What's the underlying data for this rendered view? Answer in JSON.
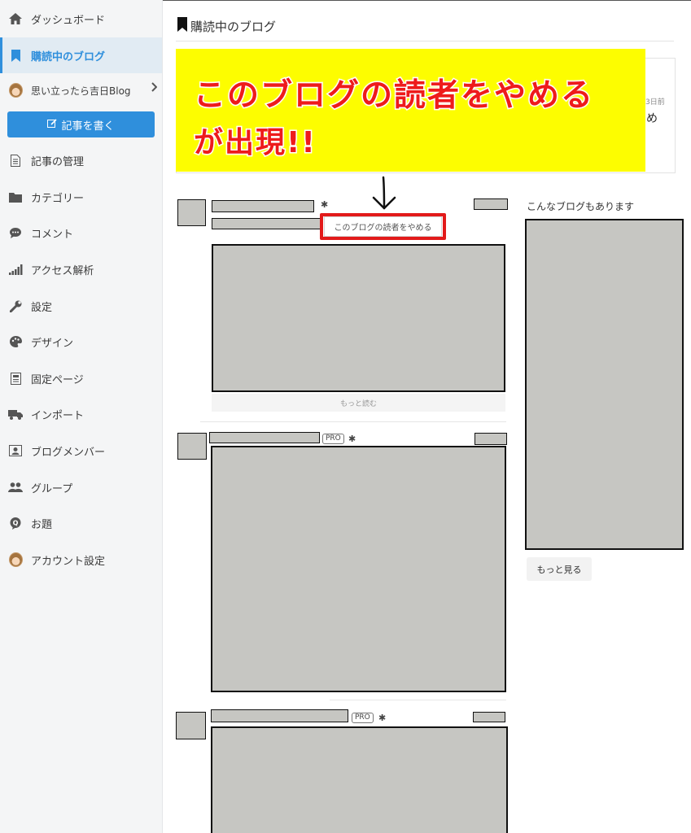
{
  "sidebar": {
    "items": [
      {
        "label": "ダッシュボード",
        "icon": "home-icon"
      },
      {
        "label": "購読中のブログ",
        "icon": "bookmark-icon",
        "active": true
      },
      {
        "label": "思い立ったら吉日Blog",
        "icon": "avatar-icon"
      },
      {
        "label": "記事の管理",
        "icon": "document-icon"
      },
      {
        "label": "カテゴリー",
        "icon": "folder-icon"
      },
      {
        "label": "コメント",
        "icon": "comment-icon"
      },
      {
        "label": "アクセス解析",
        "icon": "signal-bars-icon"
      },
      {
        "label": "設定",
        "icon": "wrench-icon"
      },
      {
        "label": "デザイン",
        "icon": "palette-icon"
      },
      {
        "label": "固定ページ",
        "icon": "page-icon"
      },
      {
        "label": "インポート",
        "icon": "truck-icon"
      },
      {
        "label": "ブログメンバー",
        "icon": "member-card-icon"
      },
      {
        "label": "グループ",
        "icon": "group-icon"
      },
      {
        "label": "お題",
        "icon": "q-bubble-icon"
      },
      {
        "label": "アカウント設定",
        "icon": "avatar-icon"
      }
    ],
    "write_button": "記事を書く"
  },
  "main": {
    "title": "購読中のブログ",
    "notice": {
      "date": "3日前",
      "trunc": "め"
    },
    "banner": {
      "line1": "このブログの読者をやめる",
      "line2": "が出現!!"
    },
    "popup_item": "このブログの読者をやめる",
    "read_more": "もっと読む",
    "pro_badge": "PRO"
  },
  "right": {
    "heading": "こんなブログもあります",
    "more_button": "もっと見る"
  },
  "colors": {
    "accent": "#2f8fdc",
    "banner_bg": "#fdfd00",
    "banner_text": "#ee1b1b",
    "highlight_border": "#e21a1a",
    "placeholder": "#c6c6c2"
  }
}
